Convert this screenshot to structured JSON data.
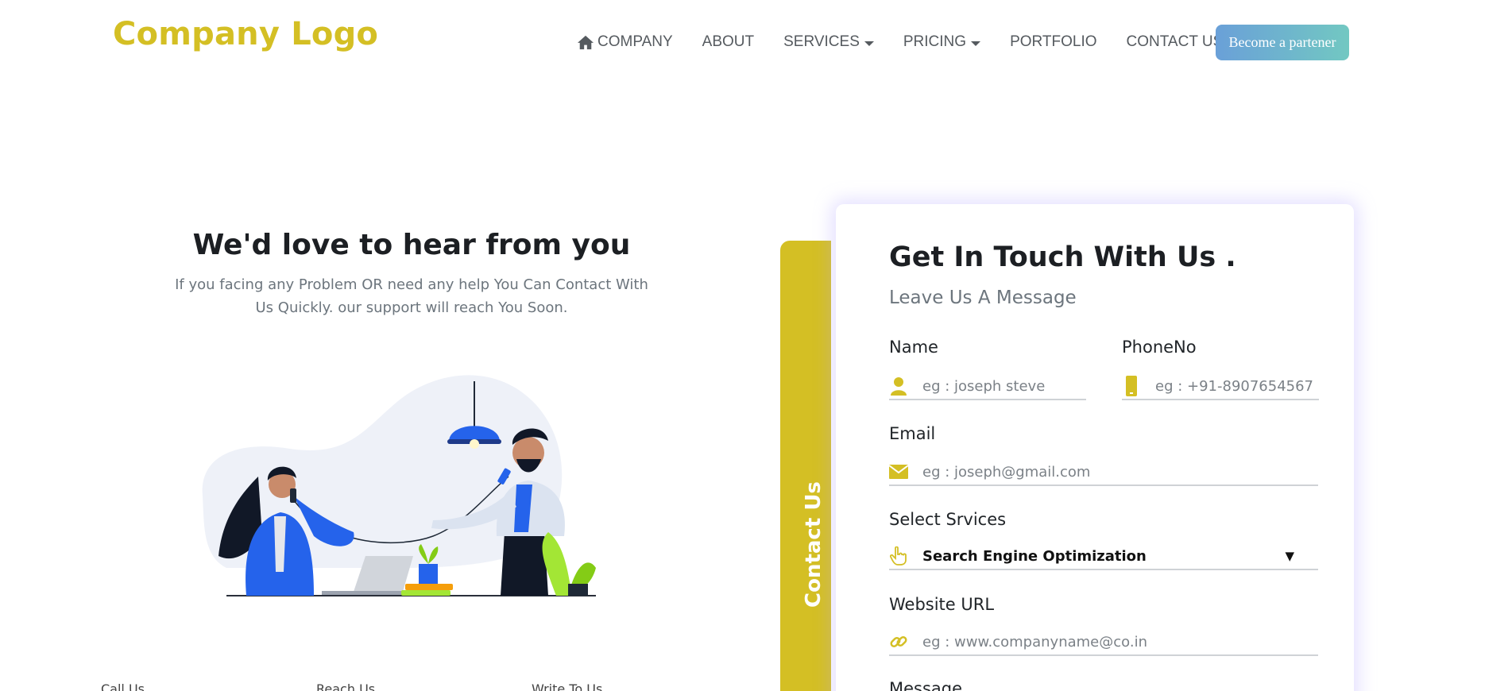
{
  "header": {
    "logo": "Company Logo",
    "nav": [
      {
        "label": "COMPANY",
        "icon": "home-icon",
        "dropdown": false
      },
      {
        "label": "ABOUT",
        "dropdown": false
      },
      {
        "label": "SERVICES",
        "dropdown": true
      },
      {
        "label": "PRICING",
        "dropdown": true
      },
      {
        "label": "PORTFOLIO",
        "dropdown": false
      },
      {
        "label": "CONTACT US",
        "dropdown": false
      }
    ],
    "cta": "Become a partener"
  },
  "intro": {
    "title": "We'd love to hear from you",
    "subtitle": "If you facing any Problem OR need any help You Can Contact With Us Quickly. our support will reach You Soon."
  },
  "bottom": {
    "labels": [
      "Call Us",
      "Reach Us",
      "Write To Us"
    ]
  },
  "contact": {
    "side_tab": "Contact Us",
    "title": "Get In Touch With Us .",
    "subtitle": "Leave Us A Message",
    "fields": {
      "name": {
        "label": "Name",
        "placeholder": "eg : joseph steve",
        "icon": "user-icon"
      },
      "phone": {
        "label": "PhoneNo",
        "placeholder": "eg : +91-8907654567",
        "icon": "mobile-icon"
      },
      "email": {
        "label": "Email",
        "placeholder": "eg : joseph@gmail.com",
        "icon": "envelope-icon"
      },
      "service": {
        "label": "Select Srvices",
        "value": "Search Engine Optimization",
        "icon": "hand-pointer-icon"
      },
      "website": {
        "label": "Website URL",
        "placeholder": "eg : www.companyname@co.in",
        "icon": "link-icon"
      },
      "message": {
        "label": "Message"
      }
    }
  },
  "colors": {
    "accent": "#d4bf24",
    "nav_text": "#555a5f",
    "cta_gradient_start": "#6aa0d8",
    "cta_gradient_end": "#72c8c2",
    "illustration_blue": "#2563eb"
  }
}
